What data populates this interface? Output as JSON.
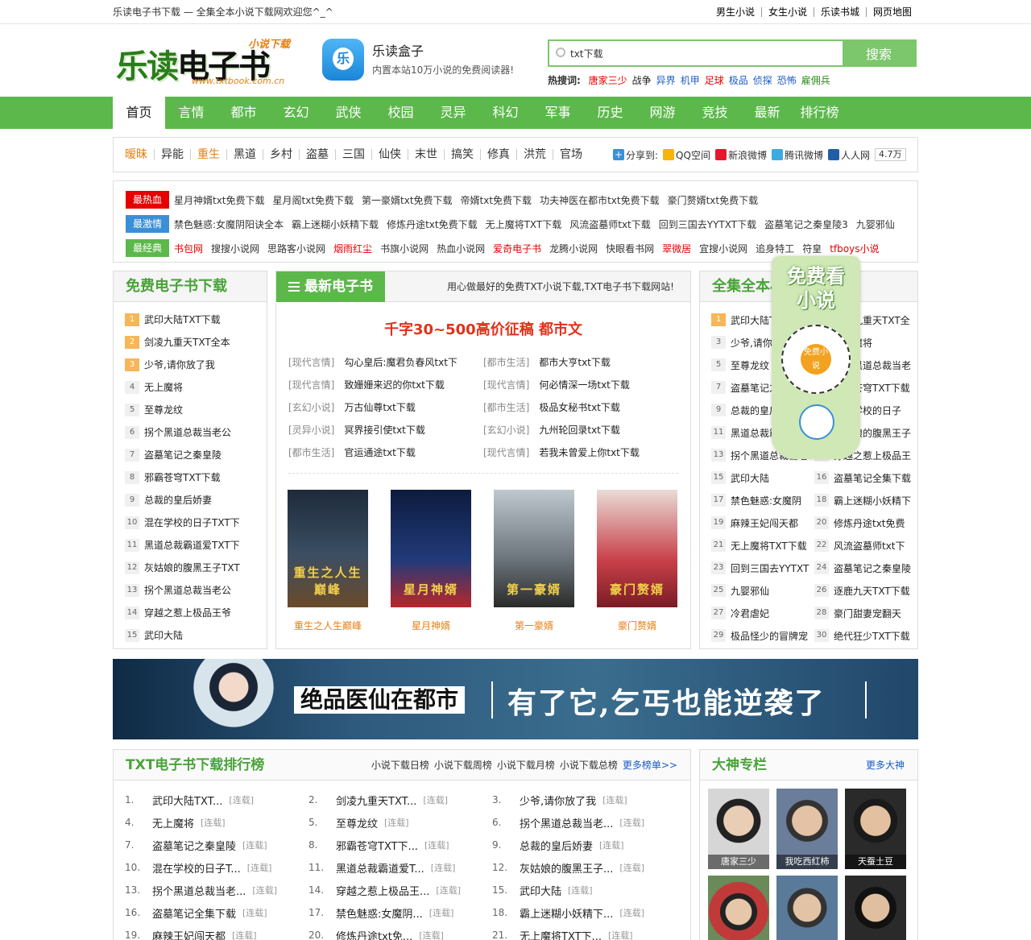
{
  "topbar": {
    "welcome": "乐读电子书下载 — 全集全本小说下载网欢迎您^_^",
    "links": [
      "男生小说",
      "女生小说",
      "乐读书城",
      "网页地图"
    ]
  },
  "logo": {
    "main_a": "乐读",
    "main_b": "电子书",
    "sub": "小说下载",
    "url": "www.txtbook.com.cn"
  },
  "app": {
    "icon_char": "乐",
    "name": "乐读盒子",
    "desc": "内置本站10万小说的免费阅读器!"
  },
  "search": {
    "value": "txt下载",
    "button": "搜索",
    "hot_label": "热搜词:",
    "hot": [
      {
        "t": "唐家三少",
        "c": "red"
      },
      {
        "t": "战争",
        "c": "dark"
      },
      {
        "t": "异界",
        "c": "blue"
      },
      {
        "t": "机甲",
        "c": "blue"
      },
      {
        "t": "足球",
        "c": "red"
      },
      {
        "t": "极品",
        "c": "blue"
      },
      {
        "t": "侦探",
        "c": "blue"
      },
      {
        "t": "恐怖",
        "c": "blue"
      },
      {
        "t": "雇佣兵",
        "c": "green"
      }
    ]
  },
  "nav": [
    "首页",
    "言情",
    "都市",
    "玄幻",
    "武侠",
    "校园",
    "灵异",
    "科幻",
    "军事",
    "历史",
    "网游",
    "竞技",
    "最新",
    "排行榜"
  ],
  "categories": [
    {
      "t": "暧昧",
      "hl": true
    },
    {
      "t": "异能",
      "hl": false
    },
    {
      "t": "重生",
      "hl": true
    },
    {
      "t": "黑道",
      "hl": false
    },
    {
      "t": "乡村",
      "hl": false
    },
    {
      "t": "盗墓",
      "hl": false
    },
    {
      "t": "三国",
      "hl": false
    },
    {
      "t": "仙侠",
      "hl": false
    },
    {
      "t": "末世",
      "hl": false
    },
    {
      "t": "搞笑",
      "hl": false
    },
    {
      "t": "修真",
      "hl": false
    },
    {
      "t": "洪荒",
      "hl": false
    },
    {
      "t": "官场",
      "hl": false
    }
  ],
  "share": {
    "label": "分享到:",
    "items": [
      {
        "t": "QQ空间",
        "c": "#f5b50a"
      },
      {
        "t": "新浪微博",
        "c": "#e6162d"
      },
      {
        "t": "腾讯微博",
        "c": "#3fa9e0"
      },
      {
        "t": "人人网",
        "c": "#1f5fa8"
      }
    ],
    "count": "4.7万"
  },
  "link_rows": [
    {
      "tag": "最热血",
      "color": "#e60000",
      "links": [
        {
          "t": "星月神婿txt免费下载",
          "r": false
        },
        {
          "t": "星月阁txt免费下载",
          "r": false
        },
        {
          "t": "第一豪婿txt免费下载",
          "r": false
        },
        {
          "t": "帝婿txt免费下载",
          "r": false
        },
        {
          "t": "功夫神医在都市txt免费下载",
          "r": false
        },
        {
          "t": "豪门赘婿txt免费下载",
          "r": false
        }
      ]
    },
    {
      "tag": "最激情",
      "color": "#3b8fd6",
      "links": [
        {
          "t": "禁色魅惑:女魔阴阳诀全本",
          "r": false
        },
        {
          "t": "霸上迷糊小妖精下载",
          "r": false
        },
        {
          "t": "修炼丹途txt免费下载",
          "r": false
        },
        {
          "t": "无上魔将TXT下载",
          "r": false
        },
        {
          "t": "风流盗墓师txt下载",
          "r": false
        },
        {
          "t": "回到三国去YYTXT下载",
          "r": false
        },
        {
          "t": "盗墓笔记之秦皇陵3",
          "r": false
        },
        {
          "t": "九婴邪仙",
          "r": false
        }
      ]
    },
    {
      "tag": "最经典",
      "color": "#5cb84b",
      "links": [
        {
          "t": "书包网",
          "r": true
        },
        {
          "t": "搜搜小说网",
          "r": false
        },
        {
          "t": "思路客小说网",
          "r": false
        },
        {
          "t": "烟雨红尘",
          "r": true
        },
        {
          "t": "书旗小说网",
          "r": false
        },
        {
          "t": "热血小说网",
          "r": false
        },
        {
          "t": "爱奇电子书",
          "r": true
        },
        {
          "t": "龙腾小说网",
          "r": false
        },
        {
          "t": "快眼看书网",
          "r": false
        },
        {
          "t": "翠微居",
          "r": true
        },
        {
          "t": "宜搜小说网",
          "r": false
        },
        {
          "t": "追身特工",
          "r": false
        },
        {
          "t": "符皇",
          "r": false
        },
        {
          "t": "tfboys小说",
          "r": true
        }
      ]
    }
  ],
  "free": {
    "title": "免费电子书下载",
    "items": [
      "武印大陆TXT下载",
      "剑凌九重天TXT全本",
      "少爷,请你放了我",
      "无上魔将",
      "至尊龙纹",
      "拐个黑道总裁当老公",
      "盗墓笔记之秦皇陵",
      "邪霸苍穹TXT下载",
      "总裁的皇后娇妻",
      "混在学校的日子TXT下",
      "黑道总裁霸道爱TXT下",
      "灰姑娘的腹黑王子TXT",
      "拐个黑道总裁当老公",
      "穿越之惹上极品王爷",
      "武印大陆"
    ]
  },
  "latest": {
    "title": "最新电子书",
    "desc": "用心做最好的免费TXT小说下载,TXT电子书下载网站!",
    "banner": "千字30~500高价征稿 都市文",
    "rows": [
      [
        {
          "c": "[现代言情]",
          "n": "勾心皇后:魔君负春风txt下"
        },
        {
          "c": "[都市生活]",
          "n": "都市大亨txt下载"
        }
      ],
      [
        {
          "c": "[现代言情]",
          "n": "致姗姗来迟的你txt下载"
        },
        {
          "c": "[现代言情]",
          "n": "何必情深一场txt下载"
        }
      ],
      [
        {
          "c": "[玄幻小说]",
          "n": "万古仙尊txt下载"
        },
        {
          "c": "[都市生活]",
          "n": "极品女秘书txt下载"
        }
      ],
      [
        {
          "c": "[灵异小说]",
          "n": "冥界接引使txt下载"
        },
        {
          "c": "[玄幻小说]",
          "n": "九州轮回录txt下载"
        }
      ],
      [
        {
          "c": "[都市生活]",
          "n": "官运通途txt下载"
        },
        {
          "c": "[现代言情]",
          "n": "若我未曾爱上你txt下载"
        }
      ]
    ],
    "covers": [
      {
        "title": "重生之人生巅峰",
        "art": "重生之人生巅峰",
        "g": "linear-gradient(#1d2a3a,#3b4e63 55%,#6a4a2a)"
      },
      {
        "title": "星月神婿",
        "art": "星月神婿",
        "g": "linear-gradient(#0d1b3d,#213a7a 60%,#b8272b)"
      },
      {
        "title": "第一豪婿",
        "art": "第一豪婿",
        "g": "linear-gradient(#bfc8cf,#6a737a 60%,#2a2a2a)"
      },
      {
        "title": "豪门赘婿",
        "art": "豪门赘婿",
        "g": "linear-gradient(#e9dcd6,#c9404a 60%,#7a1c25)"
      }
    ]
  },
  "complete": {
    "title": "全集全本小说下载",
    "items": [
      [
        "武印大陆TXT下载",
        "剑凌九重天TXT全"
      ],
      [
        "少爷,请你放了我",
        "无上魔将"
      ],
      [
        "至尊龙纹",
        "拐个黑道总裁当老"
      ],
      [
        "盗墓笔记之秦皇陵",
        "邪霸苍穹TXT下载"
      ],
      [
        "总裁的皇后娇妻",
        "混在学校的日子"
      ],
      [
        "黑道总裁霸道爱",
        "灰姑娘的腹黑王子"
      ],
      [
        "拐个黑道总裁当老",
        "穿越之惹上极品王"
      ],
      [
        "武印大陆",
        "盗墓笔记全集下载"
      ],
      [
        "禁色魅惑:女魔阴",
        "霸上迷糊小妖精下"
      ],
      [
        "麻辣王妃闯天都",
        "修炼丹途txt免费"
      ],
      [
        "无上魔将TXT下载",
        "风流盗墓师txt下"
      ],
      [
        "回到三国去YYTXT",
        "盗墓笔记之秦皇陵"
      ],
      [
        "九婴邪仙",
        "逐鹿九天TXT下载"
      ],
      [
        "冷君虐妃",
        "豪门甜妻宠翻天"
      ],
      [
        "极品怪少的冒牌宠",
        "绝代狂少TXT下载"
      ]
    ]
  },
  "promo": {
    "text": "免费看小说",
    "qr_text": "免费小说"
  },
  "ad": {
    "left": "绝品医仙在都市",
    "right": "有了它,乞丐也能逆袭了"
  },
  "ranking": {
    "title": "TXT电子书下载排行榜",
    "tabs": [
      "小说下载日榜",
      "小说下载周榜",
      "小说下载月榜",
      "小说下载总榜"
    ],
    "more": "更多榜单>>",
    "items": [
      {
        "i": "1.",
        "n": "武印大陆TXT...",
        "s": "[连载]"
      },
      {
        "i": "2.",
        "n": "剑凌九重天TXT...",
        "s": "[连载]"
      },
      {
        "i": "3.",
        "n": "少爷,请你放了我",
        "s": "[连载]"
      },
      {
        "i": "4.",
        "n": "无上魔将",
        "s": "[连载]"
      },
      {
        "i": "5.",
        "n": "至尊龙纹",
        "s": "[连载]"
      },
      {
        "i": "6.",
        "n": "拐个黑道总裁当老...",
        "s": "[连载]"
      },
      {
        "i": "7.",
        "n": "盗墓笔记之秦皇陵",
        "s": "[连载]"
      },
      {
        "i": "8.",
        "n": "邪霸苍穹TXT下...",
        "s": "[连载]"
      },
      {
        "i": "9.",
        "n": "总裁的皇后娇妻",
        "s": "[连载]"
      },
      {
        "i": "10.",
        "n": "混在学校的日子T...",
        "s": "[连载]"
      },
      {
        "i": "11.",
        "n": "黑道总裁霸道爱T...",
        "s": "[连载]"
      },
      {
        "i": "12.",
        "n": "灰姑娘的腹黑王子...",
        "s": "[连载]"
      },
      {
        "i": "13.",
        "n": "拐个黑道总裁当老...",
        "s": "[连载]"
      },
      {
        "i": "14.",
        "n": "穿越之惹上极品王...",
        "s": "[连载]"
      },
      {
        "i": "15.",
        "n": "武印大陆",
        "s": "[连载]"
      },
      {
        "i": "16.",
        "n": "盗墓笔记全集下载",
        "s": "[连载]"
      },
      {
        "i": "17.",
        "n": "禁色魅惑:女魔阴...",
        "s": "[连载]"
      },
      {
        "i": "18.",
        "n": "霸上迷糊小妖精下...",
        "s": "[连载]"
      },
      {
        "i": "19.",
        "n": "麻辣王妃闯天都",
        "s": "[连载]"
      },
      {
        "i": "20.",
        "n": "修炼丹途txt免...",
        "s": "[连载]"
      },
      {
        "i": "21.",
        "n": "无上魔将TXT下...",
        "s": "[连载]"
      }
    ]
  },
  "authors": {
    "title": "大神专栏",
    "more": "更多大神",
    "items": [
      {
        "n": "唐家三少",
        "g": "radial-gradient(circle at 50% 40%,#e9cdb5 0 26%,#222 27% 38%,#d6d6d6 39%)"
      },
      {
        "n": "我吃西红柿",
        "g": "radial-gradient(circle at 50% 40%,#e3c2a5 0 26%,#333 27% 36%,#6a7d9a 37%)"
      },
      {
        "n": "天蚕土豆",
        "g": "radial-gradient(circle at 50% 40%,#e2c0a0 0 26%,#1a1a1a 27% 38%,#2a2a2a 39%)"
      },
      {
        "n": "",
        "g": "radial-gradient(circle at 50% 45%,#e6c7aa 0 24%,#222 25% 34%,#c03a3a 35% 55%,#6a8a5a 56%)"
      },
      {
        "n": "",
        "g": "radial-gradient(circle at 50% 40%,#e2c3a6 0 24%,#333 25% 34%,#5a7a9a 35%)"
      },
      {
        "n": "",
        "g": "radial-gradient(circle at 50% 40%,#e0bfa0 0 24%,#111 25% 36%,#2a2a2a 37%)"
      }
    ]
  }
}
